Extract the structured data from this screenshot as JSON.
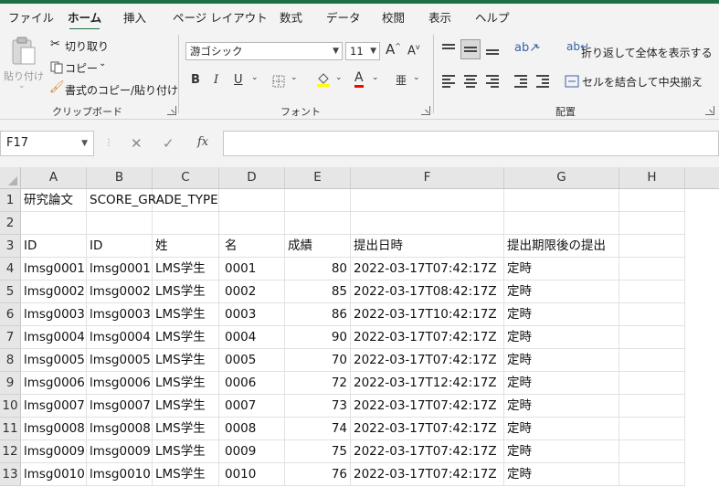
{
  "menu": {
    "tabs": [
      {
        "label": "ファイル",
        "active": false
      },
      {
        "label": "ホーム",
        "active": true
      },
      {
        "label": "挿入",
        "active": false
      },
      {
        "label": "ページ レイアウト",
        "active": false
      },
      {
        "label": "数式",
        "active": false
      },
      {
        "label": "データ",
        "active": false
      },
      {
        "label": "校閲",
        "active": false
      },
      {
        "label": "表示",
        "active": false
      },
      {
        "label": "ヘルプ",
        "active": false
      }
    ]
  },
  "ribbon": {
    "clipboard": {
      "paste_label": "貼り付け",
      "cut_label": "切り取り",
      "copy_label": "コピー",
      "format_painter_label": "書式のコピー/貼り付け",
      "group_label": "クリップボード"
    },
    "font": {
      "font_name": "游ゴシック",
      "font_size": "11",
      "grow_label": "A",
      "shrink_label": "A",
      "bold_label": "B",
      "italic_label": "I",
      "underline_label": "U",
      "font_color_label": "A",
      "phonetic_label": "亜",
      "group_label": "フォント",
      "fill_color": "#ffff00",
      "text_color": "#ff0000"
    },
    "alignment": {
      "wrap_label": "折り返して全体を表示する",
      "merge_label": "セルを結合して中央揃え",
      "group_label": "配置"
    }
  },
  "formula_bar": {
    "name_box": "F17",
    "cancel_icon": "✕",
    "enter_icon": "✓",
    "fx_label": "fx",
    "formula": ""
  },
  "grid": {
    "columns": [
      "A",
      "B",
      "C",
      "D",
      "E",
      "F",
      "G",
      "H"
    ],
    "rows": [
      {
        "num": "1",
        "cells": [
          "研究論文",
          "SCORE_GRADE_TYPE",
          "",
          "",
          "",
          "",
          "",
          ""
        ]
      },
      {
        "num": "2",
        "cells": [
          "",
          "",
          "",
          "",
          "",
          "",
          "",
          ""
        ]
      },
      {
        "num": "3",
        "cells": [
          "ID",
          "ID",
          "姓",
          "名",
          "成績",
          "提出日時",
          "提出期限後の提出",
          ""
        ]
      },
      {
        "num": "4",
        "cells": [
          "lmsg0001",
          "lmsg0001",
          "LMS学生",
          "0001",
          "80",
          "2022-03-17T07:42:17Z",
          "定時",
          ""
        ]
      },
      {
        "num": "5",
        "cells": [
          "lmsg0002",
          "lmsg0002",
          "LMS学生",
          "0002",
          "85",
          "2022-03-17T08:42:17Z",
          "定時",
          ""
        ]
      },
      {
        "num": "6",
        "cells": [
          "lmsg0003",
          "lmsg0003",
          "LMS学生",
          "0003",
          "86",
          "2022-03-17T10:42:17Z",
          "定時",
          ""
        ]
      },
      {
        "num": "7",
        "cells": [
          "lmsg0004",
          "lmsg0004",
          "LMS学生",
          "0004",
          "90",
          "2022-03-17T07:42:17Z",
          "定時",
          ""
        ]
      },
      {
        "num": "8",
        "cells": [
          "lmsg0005",
          "lmsg0005",
          "LMS学生",
          "0005",
          "70",
          "2022-03-17T07:42:17Z",
          "定時",
          ""
        ]
      },
      {
        "num": "9",
        "cells": [
          "lmsg0006",
          "lmsg0006",
          "LMS学生",
          "0006",
          "72",
          "2022-03-17T12:42:17Z",
          "定時",
          ""
        ]
      },
      {
        "num": "10",
        "cells": [
          "lmsg0007",
          "lmsg0007",
          "LMS学生",
          "0007",
          "73",
          "2022-03-17T07:42:17Z",
          "定時",
          ""
        ]
      },
      {
        "num": "11",
        "cells": [
          "lmsg0008",
          "lmsg0008",
          "LMS学生",
          "0008",
          "74",
          "2022-03-17T07:42:17Z",
          "定時",
          ""
        ]
      },
      {
        "num": "12",
        "cells": [
          "lmsg0009",
          "lmsg0009",
          "LMS学生",
          "0009",
          "75",
          "2022-03-17T07:42:17Z",
          "定時",
          ""
        ]
      },
      {
        "num": "13",
        "cells": [
          "lmsg0010",
          "lmsg0010",
          "LMS学生",
          "0010",
          "76",
          "2022-03-17T07:42:17Z",
          "定時",
          ""
        ]
      }
    ]
  }
}
